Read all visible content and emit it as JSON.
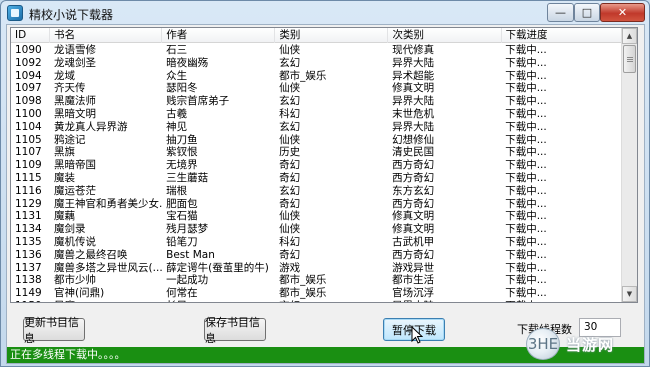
{
  "window": {
    "title": "精校小说下载器",
    "min_glyph": "—",
    "max_glyph": "□",
    "close_glyph": "✕"
  },
  "table": {
    "columns": [
      "ID",
      "书名",
      "作者",
      "类别",
      "次类别",
      "下载进度"
    ],
    "rows": [
      [
        "1090",
        "龙语雪修",
        "石三",
        "仙侠",
        "现代修真",
        "下载中..."
      ],
      [
        "1092",
        "龙魂剑圣",
        "暗夜幽殇",
        "玄幻",
        "异界大陆",
        "下载中..."
      ],
      [
        "1094",
        "龙域",
        "众生",
        "都市_娱乐",
        "异术超能",
        "下载中..."
      ],
      [
        "1097",
        "齐天传",
        "瑟阳冬",
        "仙侠",
        "修真文明",
        "下载中..."
      ],
      [
        "1098",
        "黑魔法师",
        "贱宗首席弟子",
        "玄幻",
        "异界大陆",
        "下载中..."
      ],
      [
        "1100",
        "黑暗文明",
        "古羲",
        "科幻",
        "末世危机",
        "下载中..."
      ],
      [
        "1104",
        "黄龙真人异界游",
        "神见",
        "玄幻",
        "异界大陆",
        "下载中..."
      ],
      [
        "1105",
        "鸦途记",
        "抽刀鱼",
        "仙侠",
        "幻想修仙",
        "下载中..."
      ],
      [
        "1107",
        "黑旗",
        "紫钗恨",
        "历史",
        "清史民国",
        "下载中..."
      ],
      [
        "1109",
        "黑暗帝国",
        "无境界",
        "奇幻",
        "西方奇幻",
        "下载中..."
      ],
      [
        "1115",
        "魔装",
        "三生蘑菇",
        "奇幻",
        "西方奇幻",
        "下载中..."
      ],
      [
        "1116",
        "魔运苍茫",
        "瑞根",
        "玄幻",
        "东方玄幻",
        "下载中..."
      ],
      [
        "1129",
        "魔王神官和勇者美少女...",
        "肥面包",
        "奇幻",
        "西方奇幻",
        "下载中..."
      ],
      [
        "1131",
        "魔藕",
        "宝石猫",
        "仙侠",
        "修真文明",
        "下载中..."
      ],
      [
        "1134",
        "魔剑录",
        "残月瑟梦",
        "仙侠",
        "修真文明",
        "下载中..."
      ],
      [
        "1135",
        "魔机传说",
        "铅笔刀",
        "科幻",
        "古武机甲",
        "下载中..."
      ],
      [
        "1136",
        "魔兽之最终召唤",
        "Best Man",
        "奇幻",
        "西方奇幻",
        "下载中..."
      ],
      [
        "1137",
        "魔兽多塔之异世风云(...",
        "薛定谔牛(蚕茧里的牛)",
        "游戏",
        "游戏异世",
        "下载中..."
      ],
      [
        "1138",
        "都市少帅",
        "一起成功",
        "都市_娱乐",
        "都市生活",
        "下载中..."
      ],
      [
        "1149",
        "官神(问鼎)",
        "何常在",
        "都市_娱乐",
        "官场沉浮",
        "下载中..."
      ],
      [
        "1150",
        "风魔",
        "长风",
        "玄幻",
        "异界大陆",
        "下载中..."
      ]
    ]
  },
  "buttons": {
    "update": "更新书目信息",
    "save": "保存书目信息",
    "pause": "暂停下载"
  },
  "threads": {
    "label": "下载线程数",
    "value": "30"
  },
  "status": {
    "text": "正在多线程下载中。。。。"
  },
  "watermark": {
    "text": "当游网",
    "badge": "3HE"
  },
  "colors": {
    "status_bg": "#1a8f12",
    "title_bg": "#c3d8ec"
  }
}
